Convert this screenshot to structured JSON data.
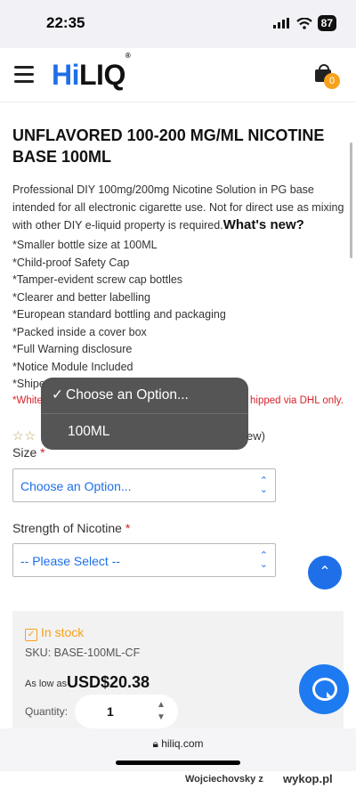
{
  "status": {
    "time": "22:35",
    "battery": "87"
  },
  "header": {
    "logo_hi": "Hi",
    "logo_liq": "LIQ",
    "logo_reg": "®",
    "cart_count": "0"
  },
  "product": {
    "title": "UNFLAVORED 100-200 MG/ML NICOTINE BASE 100ML",
    "description": "Professional DIY 100mg/200mg Nicotine Solution in PG base intended for all electronic cigarette use. Not for direct use as mixing with other DIY e-liquid property is required.",
    "whats_new": "What's new?",
    "features": [
      "*Smaller bottle size at 100ML",
      "*Child-proof Safety Cap",
      "*Tamper-evident screw cap bottles",
      "*Clearer and better labelling",
      "*European standard bottling and packaging",
      "*Packed inside a cover box",
      "*Full Warning disclosure",
      "*Notice Module Included",
      "*Shipe"
    ],
    "warning_start": "*White",
    "warning_end": "hipped via DHL only.",
    "stars": "☆☆",
    "review_tail": "ew)"
  },
  "size": {
    "label": "Size",
    "required": "*",
    "value": "Choose an Option..."
  },
  "strength": {
    "label": "Strength of Nicotine",
    "required": "*",
    "value": "-- Please Select --"
  },
  "dropdown": {
    "options": [
      "Choose an Option...",
      "100ML"
    ],
    "checkmark": "✓"
  },
  "stock": {
    "status": "In stock",
    "sku": "SKU: BASE-100ML-CF",
    "as_low_as": "As low as",
    "price": "USD$20.38",
    "qty_label": "Quantity:",
    "qty_value": "1"
  },
  "browser": {
    "url": "hiliq.com"
  },
  "watermark": {
    "user": "Wojciechovsky z",
    "site": "wykop.pl"
  },
  "colors": {
    "accent": "#1e6fe8",
    "warning": "#d8232a",
    "stock": "#f7a21b"
  }
}
